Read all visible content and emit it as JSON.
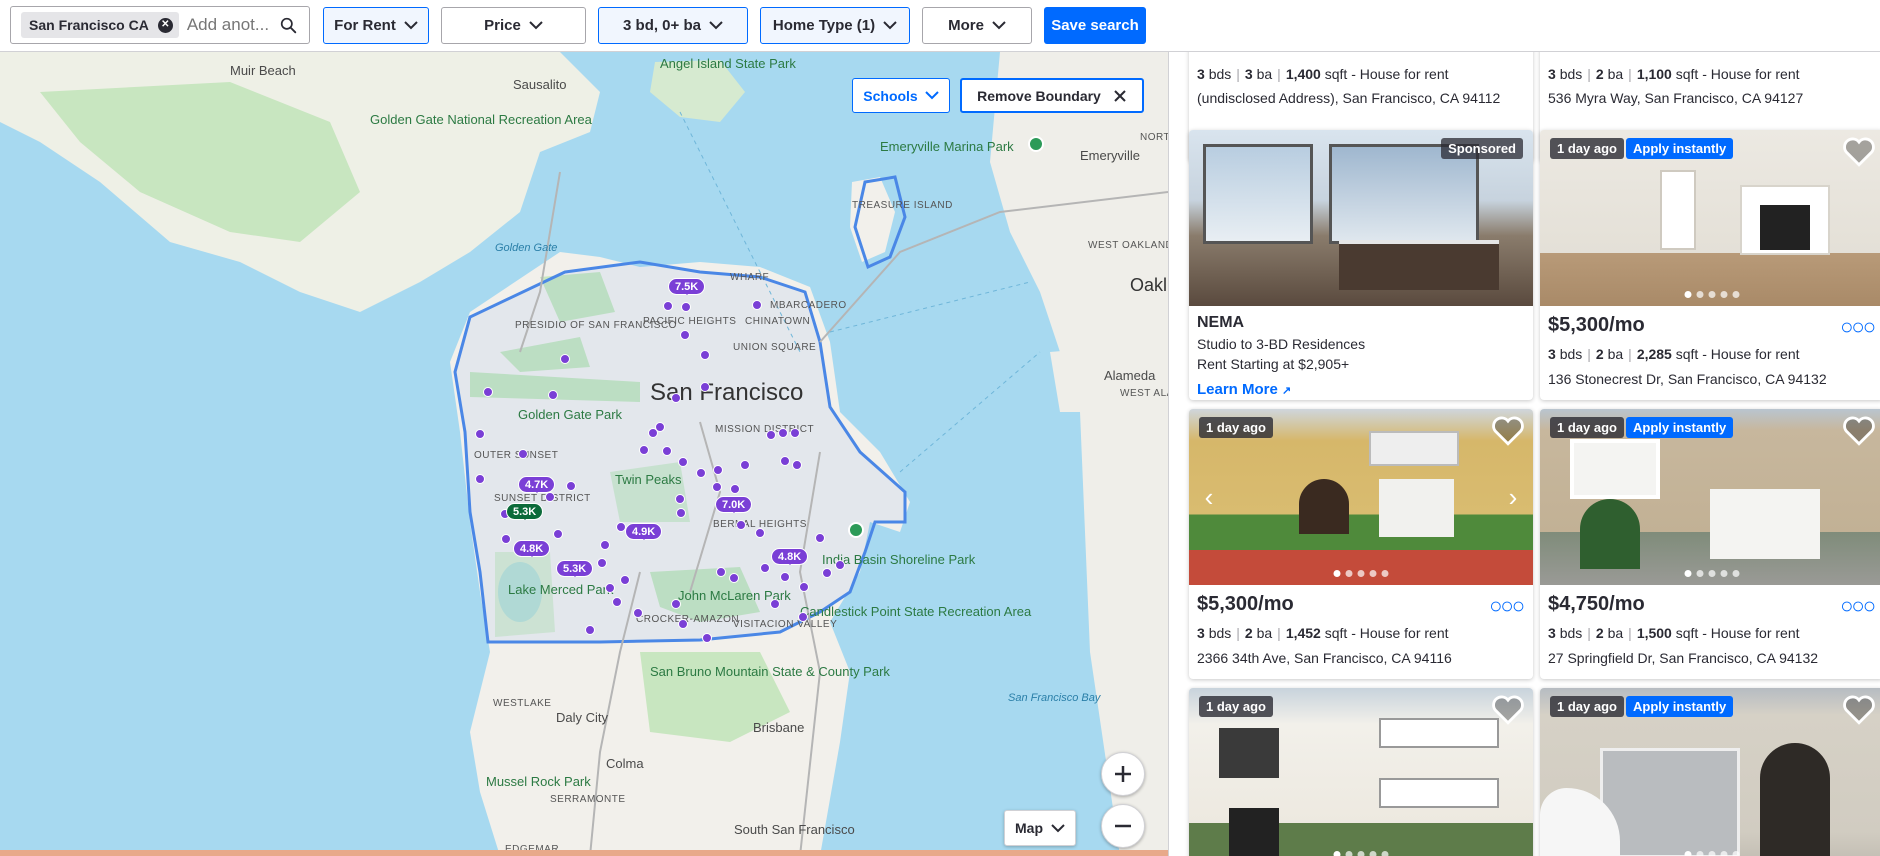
{
  "search": {
    "chip_label": "San Francisco CA",
    "placeholder": "Add anot..."
  },
  "filters": {
    "for_rent": "For Rent",
    "price": "Price",
    "beds_baths": "3 bd, 0+ ba",
    "home_type": "Home Type (1)",
    "more": "More",
    "save_search": "Save search"
  },
  "map": {
    "schools": "Schools",
    "remove_boundary": "Remove Boundary",
    "map_type": "Map",
    "city_label": "San Francisco",
    "pins": [
      "7.5K",
      "4.7K",
      "5.3K",
      "4.8K",
      "5.3K",
      "4.9K",
      "7.0K",
      "4.8K"
    ],
    "place_labels": {
      "muir_beach": "Muir Beach",
      "sausalito": "Sausalito",
      "angel_island": "Angel Island State Park",
      "golden_gate_nra": "Golden Gate National Recreation Area",
      "emeryville_marina": "Emeryville Marina Park",
      "emeryville": "Emeryville",
      "treasure_island": "TREASURE ISLAND",
      "golden_gate": "Golden Gate",
      "wharf": "WHARF",
      "embarcadero": "MBARCADERO",
      "pacific_heights": "PACIFIC HEIGHTS",
      "chinatown": "CHINATOWN",
      "presidio": "PRESIDIO OF SAN FRANCISCO",
      "union_square": "UNION SQUARE",
      "west_oakland": "WEST OAKLAND",
      "oakland": "Oakl",
      "alameda": "Alameda",
      "west_alameda": "WEST ALA",
      "golden_gate_park": "Golden Gate Park",
      "mission": "MISSION DISTRICT",
      "outer_sunset": "OUTER SUNSET",
      "twin_peaks": "Twin Peaks",
      "sunset_district": "SUNSET DISTRICT",
      "bernal_heights": "BERNAL HEIGHTS",
      "india_basin": "India Basin Shoreline Park",
      "lake_merced": "Lake Merced Park",
      "john_mclaren": "John McLaren Park",
      "crocker": "CROCKER-AMAZON",
      "visitacion": "VISITACION VALLEY",
      "candlestick": "Candlestick Point State Recreation Area",
      "san_bruno": "San Bruno Mountain State & County Park",
      "westlake": "WESTLAKE",
      "daly_city": "Daly City",
      "brisbane": "Brisbane",
      "sf_bay": "San Francisco Bay",
      "colma": "Colma",
      "mussel_rock": "Mussel Rock Park",
      "serramonte": "SERRAMONTE",
      "south_sf": "South San Francisco",
      "edgemar": "EDGEMAR",
      "north": "NORTH"
    }
  },
  "listings": {
    "top_left": {
      "facts": {
        "beds": "3",
        "baths": "3",
        "sqft": "1,400",
        "type": "House for rent"
      },
      "address": "(undisclosed Address), San Francisco, CA 94112"
    },
    "top_right": {
      "facts": {
        "beds": "3",
        "baths": "2",
        "sqft": "1,100",
        "type": "House for rent"
      },
      "address": "536 Myra Way, San Francisco, CA 94127"
    },
    "sponsored": {
      "badge": "Sponsored",
      "title": "NEMA",
      "line1": "Studio to 3-BD Residences",
      "line2": "Rent Starting at $2,905+",
      "learn_more": "Learn More"
    },
    "cards": [
      {
        "badge": "1 day ago",
        "apply": "Apply instantly",
        "price": "$5,300/mo",
        "beds": "3",
        "baths": "2",
        "sqft": "2,285",
        "type": "House for rent",
        "address": "136 Stonecrest Dr, San Francisco, CA 94132"
      },
      {
        "badge": "1 day ago",
        "apply": "",
        "price": "$5,300/mo",
        "beds": "3",
        "baths": "2",
        "sqft": "1,452",
        "type": "House for rent",
        "address": "2366 34th Ave, San Francisco, CA 94116"
      },
      {
        "badge": "1 day ago",
        "apply": "Apply instantly",
        "price": "$4,750/mo",
        "beds": "3",
        "baths": "2",
        "sqft": "1,500",
        "type": "House for rent",
        "address": "27 Springfield Dr, San Francisco, CA 94132"
      },
      {
        "badge": "1 day ago",
        "apply": ""
      },
      {
        "badge": "1 day ago",
        "apply": "Apply instantly"
      }
    ],
    "labels": {
      "bds": "bds",
      "ba": "ba",
      "sqft": "sqft"
    }
  },
  "colors": {
    "accent": "#006aff",
    "pin": "#7a3fd6",
    "pin_selected": "#0c6b3a",
    "water": "#a7d9f0",
    "land": "#f2f0eb",
    "park": "#c8e6c0"
  }
}
